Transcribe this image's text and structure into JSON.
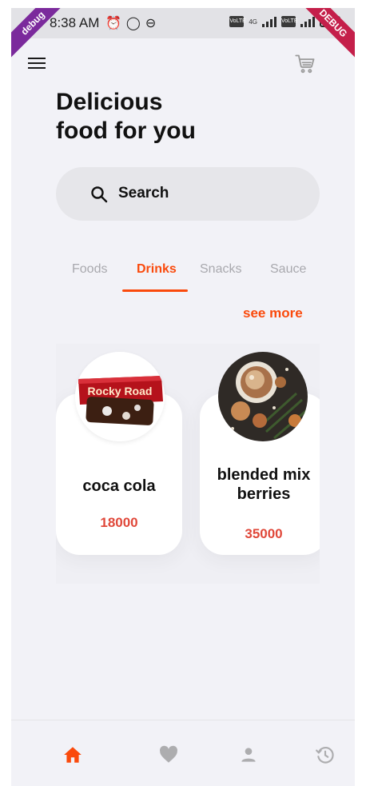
{
  "status_bar": {
    "time": "8:38 AM",
    "left_icons": [
      "alarm-icon",
      "whatsapp-icon",
      "sim-icon"
    ],
    "network": "4G",
    "battery": "4"
  },
  "debug": {
    "left_ribbon": "debug",
    "right_ribbon": "DEBUG"
  },
  "header": {
    "title_line1": "Delicious",
    "title_line2": "food for you",
    "menu_icon": "hamburger-menu-icon",
    "cart_icon": "shopping-cart-icon"
  },
  "search": {
    "label": "Search",
    "icon": "search-icon"
  },
  "tabs": [
    {
      "label": "Foods",
      "active": false
    },
    {
      "label": "Drinks",
      "active": true
    },
    {
      "label": "Snacks",
      "active": false
    },
    {
      "label": "Sauce",
      "active": false
    }
  ],
  "see_more": "see more",
  "products": [
    {
      "name": "coca cola",
      "price": "18000",
      "image": "rocky-road-chocolate-bar",
      "image_label": "Rocky Road"
    },
    {
      "name_line1": "blended mix",
      "name_line2": "berries",
      "price": "35000",
      "image": "hot-cocoa-cookies"
    }
  ],
  "bottom_nav": [
    {
      "icon": "home-icon",
      "active": true
    },
    {
      "icon": "heart-icon",
      "active": false
    },
    {
      "icon": "profile-icon",
      "active": false
    },
    {
      "icon": "history-icon",
      "active": false
    }
  ],
  "colors": {
    "accent": "#fa4a0c",
    "price": "#e0483a",
    "background": "#f2f2f7",
    "inactive": "#adadaf"
  }
}
